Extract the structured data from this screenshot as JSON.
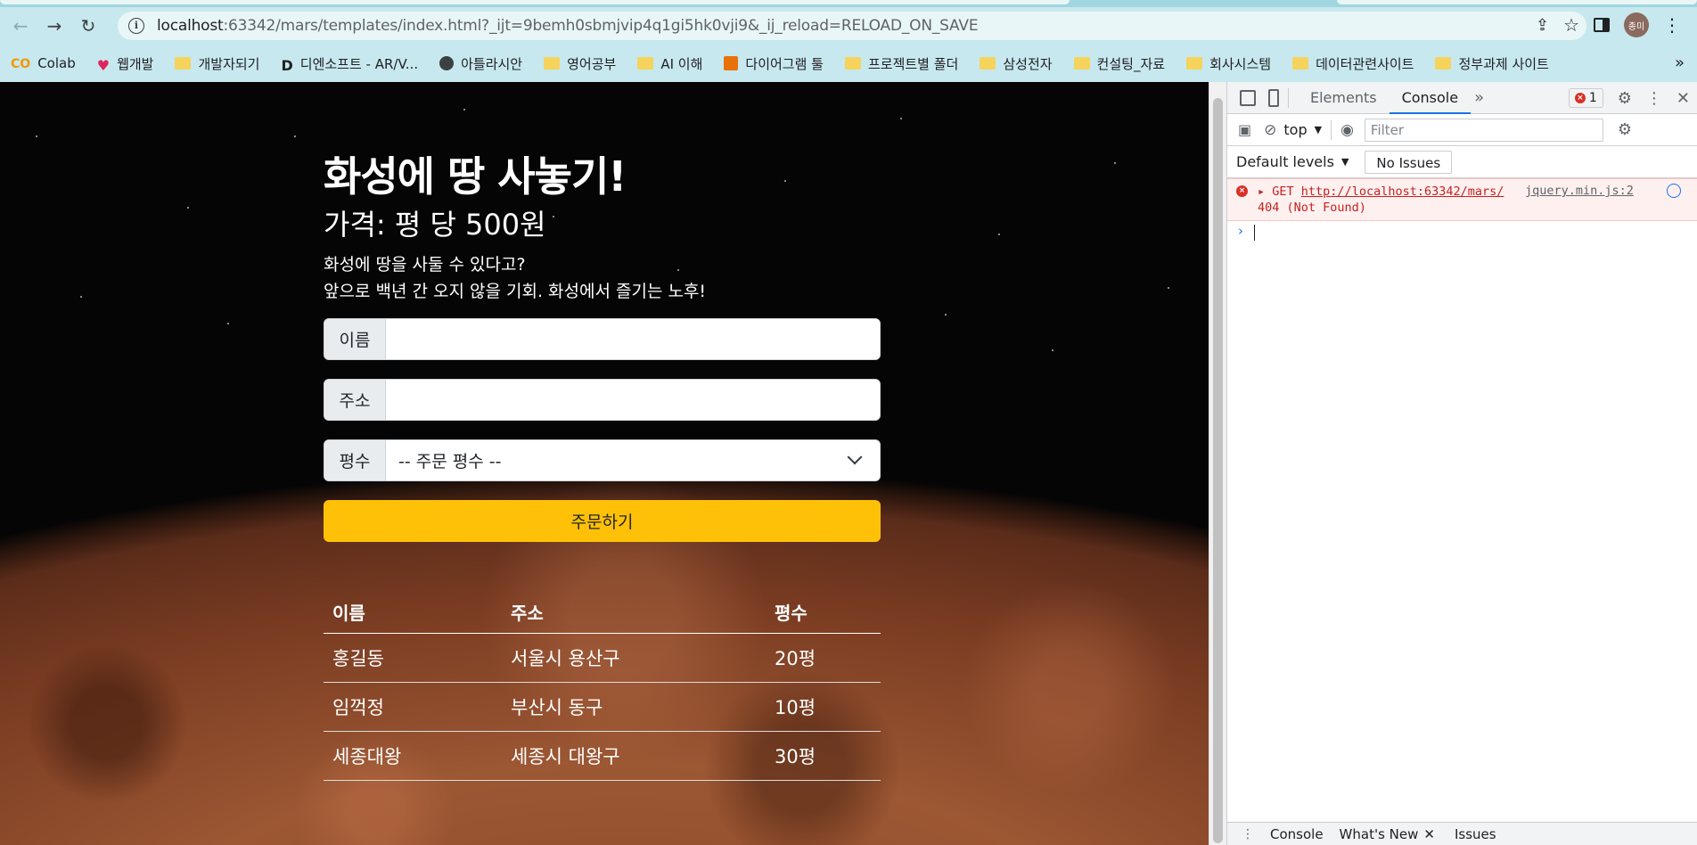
{
  "browser": {
    "url_host": "localhost",
    "url_rest": ":63342/mars/templates/index.html?_ijt=9bemh0sbmjvip4q1gi5hk0vji9&_ij_reload=RELOAD_ON_SAVE",
    "avatar_text": "종미"
  },
  "bookmarks": [
    {
      "label": "Colab",
      "icon": "colab-icon"
    },
    {
      "label": "웹개발",
      "icon": "heart-icon"
    },
    {
      "label": "개발자되기",
      "icon": "folder-icon"
    },
    {
      "label": "디엔소프트 - AR/V...",
      "icon": "d-logo-icon"
    },
    {
      "label": "아틀라시안",
      "icon": "globe-icon"
    },
    {
      "label": "영어공부",
      "icon": "folder-icon"
    },
    {
      "label": "AI 이해",
      "icon": "folder-icon"
    },
    {
      "label": "다이어그램 툴",
      "icon": "diagram-icon"
    },
    {
      "label": "프로젝트별 폴더",
      "icon": "folder-icon"
    },
    {
      "label": "삼성전자",
      "icon": "folder-icon"
    },
    {
      "label": "컨설팅_자료",
      "icon": "folder-icon"
    },
    {
      "label": "회사시스템",
      "icon": "folder-icon"
    },
    {
      "label": "데이터관련사이트",
      "icon": "folder-icon"
    },
    {
      "label": "정부과제 사이트",
      "icon": "folder-icon"
    }
  ],
  "page": {
    "title": "화성에 땅 사놓기!",
    "price": "가격: 평 당 500원",
    "desc_line1": "화성에 땅을 사둘 수 있다고?",
    "desc_line2": "앞으로 백년 간 오지 않을 기회. 화성에서 즐기는 노후!",
    "name_label": "이름",
    "name_value": "",
    "address_label": "주소",
    "address_value": "",
    "size_label": "평수",
    "size_selected": "-- 주문 평수 --",
    "order_button": "주문하기",
    "table": {
      "headers": [
        "이름",
        "주소",
        "평수"
      ],
      "rows": [
        [
          "홍길동",
          "서울시 용산구",
          "20평"
        ],
        [
          "임꺽정",
          "부산시 동구",
          "10평"
        ],
        [
          "세종대왕",
          "세종시 대왕구",
          "30평"
        ]
      ]
    }
  },
  "devtools": {
    "tabs": [
      "Elements",
      "Console"
    ],
    "active_tab": "Console",
    "error_count": "1",
    "context": "top",
    "filter_placeholder": "Filter",
    "levels": "Default levels",
    "issues": "No Issues",
    "error_method": "GET",
    "error_url": "http://localhost:63342/mars/",
    "error_status": "404 (Not Found)",
    "error_source": "jquery.min.js:2",
    "drawer_tabs": [
      "Console",
      "What's New",
      "Issues"
    ]
  }
}
